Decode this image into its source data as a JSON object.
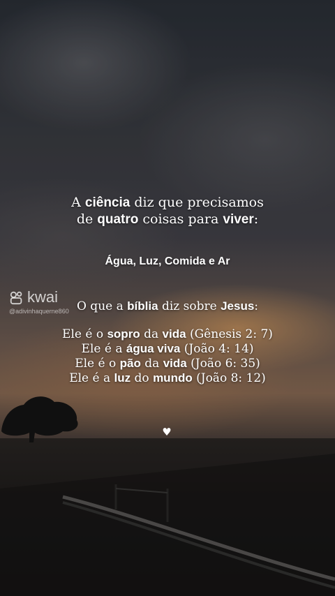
{
  "watermark": {
    "brand": "kwai",
    "icon": "kwai-logo-icon",
    "handle": "@adivinhaquerne860"
  },
  "message": {
    "line1": {
      "a": "A ",
      "b": "ciência",
      "c": " diz que precisamos"
    },
    "line2": {
      "a": "de ",
      "b": "quatro",
      "c": " coisas para ",
      "d": "viver",
      "e": ":"
    },
    "needs": "Água, Luz, Comida e Ar",
    "question": {
      "a": "O que a ",
      "b": "bíblia",
      "c": " diz sobre ",
      "d": "Jesus",
      "e": ":"
    },
    "verses": [
      {
        "a": "Ele é o ",
        "b": "sopro",
        "c": " da ",
        "d": "vida",
        "e": " (Gênesis 2: 7)"
      },
      {
        "a": "Ele é a ",
        "b": "água viva",
        "c": " (João 4: 14)"
      },
      {
        "a": "Ele é o ",
        "b": "pão",
        "c": " da ",
        "d": "vida",
        "e": " (João 6: 35)"
      },
      {
        "a": "Ele é a ",
        "b": "luz",
        "c": " do ",
        "d": "mundo",
        "e": " (João 8: 12)"
      }
    ]
  },
  "heart": "♥",
  "colors": {
    "text": "#ffffff",
    "sunset": "#cd965f",
    "sky": "#3a3c42"
  }
}
